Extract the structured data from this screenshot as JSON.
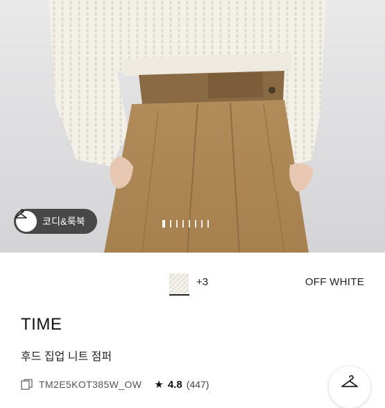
{
  "gallery": {
    "look_button_label": "코디&룩북",
    "indicator_count": 8,
    "active_index": 0
  },
  "color_selector": {
    "more_count": "+3",
    "selected_color": "OFF WHITE"
  },
  "product": {
    "brand": "TIME",
    "name": "후드 집업 니트 점퍼",
    "code": "TM2E5KOT385W_OW",
    "rating": "4.8",
    "review_count": "(447)"
  },
  "icons": {
    "look_button": "hanger-icon",
    "code": "copy-icon",
    "rating": "star-icon",
    "fab": "hanger-icon"
  },
  "colors": {
    "chip_bg": "#282828",
    "accent": "#111111"
  }
}
